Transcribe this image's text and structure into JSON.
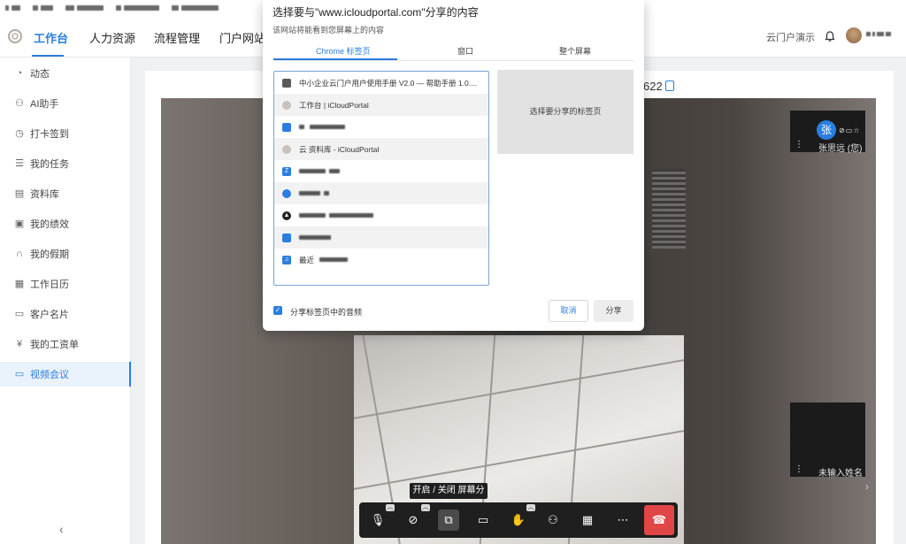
{
  "header": {
    "nav": [
      "工作台",
      "人力资源",
      "流程管理",
      "门户网站"
    ],
    "tenant": "云门户演示"
  },
  "sidebar": {
    "items": [
      {
        "label": "动态",
        "icon": "activity-icon"
      },
      {
        "label": "AI助手",
        "icon": "person-icon"
      },
      {
        "label": "打卡签到",
        "icon": "clock-icon"
      },
      {
        "label": "我的任务",
        "icon": "list-icon"
      },
      {
        "label": "资料库",
        "icon": "document-icon"
      },
      {
        "label": "我的绩效",
        "icon": "performance-icon"
      },
      {
        "label": "我的假期",
        "icon": "headphones-icon"
      },
      {
        "label": "工作日历",
        "icon": "calendar-icon"
      },
      {
        "label": "客户名片",
        "icon": "card-icon"
      },
      {
        "label": "我的工资单",
        "icon": "yen-icon"
      },
      {
        "label": "视频会议",
        "icon": "video-icon"
      }
    ],
    "active": "视频会议"
  },
  "meeting": {
    "id_suffix": "622",
    "participants": [
      {
        "avatar": "张",
        "name": "张思远 (您)"
      },
      {
        "name": "未输入姓名"
      }
    ],
    "tooltip": "开启 / 关闭 屏幕分享"
  },
  "share_dialog": {
    "title": "选择要与\"www.icloudportal.com\"分享的内容",
    "subtitle": "该网站将能看到您屏幕上的内容",
    "tabs": [
      "Chrome 标签页",
      "窗口",
      "整个屏幕"
    ],
    "tab_list": [
      {
        "title": "中小企业云门户用户使用手册 V2.0 — 帮助手册 1.0....",
        "favicon_color": "#5a5a5a"
      },
      {
        "title": "工作台 | iCloudPortal",
        "favicon_color": "#c8c2bc"
      },
      {
        "title": "",
        "favicon_color": "#2a7ee0"
      },
      {
        "title": "云 资料库 - iCloudPortal",
        "favicon_color": "#c8c2bc"
      },
      {
        "title": "",
        "favicon_color": "#2a7ee0"
      },
      {
        "title": "",
        "favicon_color": "#2a7ee0"
      },
      {
        "title": "",
        "favicon_color": "#222222"
      },
      {
        "title": "",
        "favicon_color": "#2a7ee0"
      },
      {
        "title": "最近",
        "favicon_color": "#2a7ee0"
      }
    ],
    "preview_text": "选择要分享的标签页",
    "share_audio_label": "分享标签页中的音频",
    "share_audio_checked": true,
    "cancel_label": "取消",
    "share_label": "分享"
  }
}
